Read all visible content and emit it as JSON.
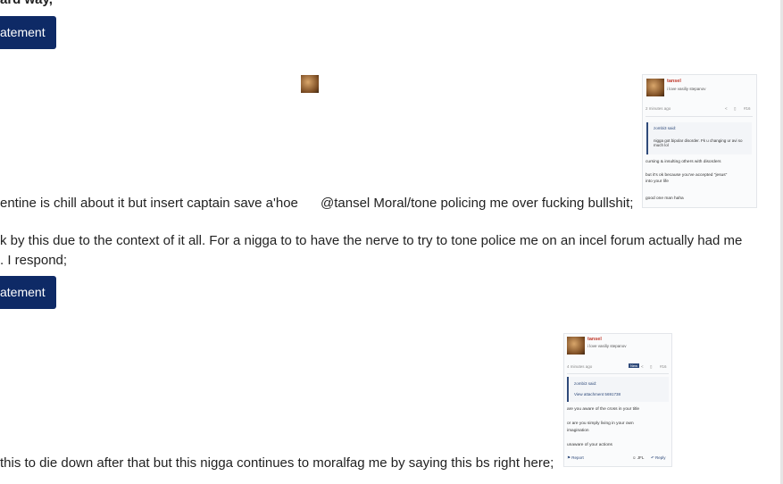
{
  "post": {
    "line_top": "ard way,",
    "button_label": "atement",
    "line_chill": "entine is chill about it but insert captain save a'hoe",
    "line_mention": "@tansel Moral/tone policing me over fucking bullshit;",
    "line_context": "k by this due to the context of it all. For a nigga to to have the nerve to try to tone police me on an incel forum actually had me",
    "line_respond": ". I respond;",
    "line_bottom": "this to die down after that but this nigga continues to moralfag me by saying this bs right here;"
  },
  "embed1": {
    "username": "tansel",
    "tagline": "i love vasiliy stepanov",
    "timestamp": "2 minutes ago",
    "post_num": "#16",
    "quote_author": "zombi3 said:",
    "quote_text": "nigga got bipolar disorder. Fk u changing ur avi so much lol",
    "body1": "cursing & insulting others with disorders",
    "body2": "but it's ok because you've accepted \"jesus\"",
    "body2b": "into your life",
    "body3": "good one man haha"
  },
  "embed2": {
    "username": "tansel",
    "tagline": "i love vasiliy stepanov",
    "timestamp": "4 minutes ago",
    "new_badge": "New",
    "post_num": "#16",
    "quote_author": "zombi3 said:",
    "quote_link": "View attachment 5691738",
    "body1": "are you aware of the cross in your title",
    "body2": "or are you simply living in your own",
    "body2b": "imagination",
    "body3": "unaware of your actions",
    "report": "Report",
    "react": "JFL",
    "reply": "Reply"
  }
}
